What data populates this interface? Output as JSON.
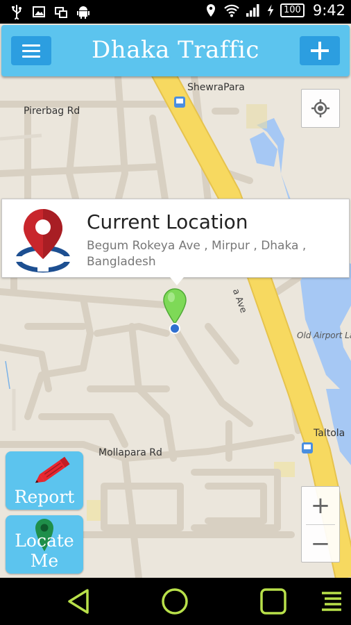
{
  "status_bar": {
    "battery": "100",
    "time": "9:42",
    "icons": [
      "usb-icon",
      "image-icon",
      "screens-icon",
      "android-icon",
      "location-icon",
      "wifi-icon",
      "signal-icon",
      "charging-icon"
    ]
  },
  "header": {
    "title": "Dhaka Traffic",
    "menu_icon": "hamburger-menu-icon",
    "add_icon": "plus-icon",
    "color": "#5cc4ee",
    "button_color": "#2c9ee0"
  },
  "map": {
    "labels": {
      "shewrapara": "ShewraPara",
      "pirerbag": "Pirerbag Rd",
      "begum_ave": "a Ave",
      "old_airport": "Old Airport Lak",
      "taltola": "Taltola",
      "mollapara": "Mollapara Rd"
    },
    "road_color": "#f7d960",
    "water_color": "#a6c8f4",
    "land_color": "#ebe6dc"
  },
  "info_window": {
    "title": "Current Location",
    "address": "Begum Rokeya Ave , Mirpur , Dhaka , Bangladesh",
    "icon": "map-pin-location-icon"
  },
  "controls": {
    "my_location_icon": "crosshair-icon",
    "zoom_in": "+",
    "zoom_out": "−"
  },
  "buttons": {
    "report": "Report",
    "locate_me": "Locate Me"
  },
  "nav_bar": {
    "icons": [
      "back-icon",
      "home-icon",
      "recents-icon",
      "menu-icon"
    ],
    "color": "#b8e04a"
  }
}
